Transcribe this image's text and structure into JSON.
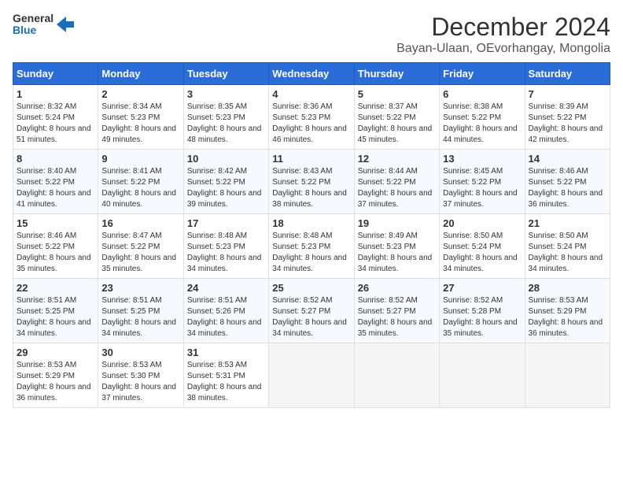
{
  "logo": {
    "text_general": "General",
    "text_blue": "Blue"
  },
  "title": "December 2024",
  "subtitle": "Bayan-Ulaan, OEvorhangay, Mongolia",
  "days_of_week": [
    "Sunday",
    "Monday",
    "Tuesday",
    "Wednesday",
    "Thursday",
    "Friday",
    "Saturday"
  ],
  "weeks": [
    [
      {
        "day": "1",
        "sunrise": "8:32 AM",
        "sunset": "5:24 PM",
        "daylight": "8 hours and 51 minutes."
      },
      {
        "day": "2",
        "sunrise": "8:34 AM",
        "sunset": "5:23 PM",
        "daylight": "8 hours and 49 minutes."
      },
      {
        "day": "3",
        "sunrise": "8:35 AM",
        "sunset": "5:23 PM",
        "daylight": "8 hours and 48 minutes."
      },
      {
        "day": "4",
        "sunrise": "8:36 AM",
        "sunset": "5:23 PM",
        "daylight": "8 hours and 46 minutes."
      },
      {
        "day": "5",
        "sunrise": "8:37 AM",
        "sunset": "5:22 PM",
        "daylight": "8 hours and 45 minutes."
      },
      {
        "day": "6",
        "sunrise": "8:38 AM",
        "sunset": "5:22 PM",
        "daylight": "8 hours and 44 minutes."
      },
      {
        "day": "7",
        "sunrise": "8:39 AM",
        "sunset": "5:22 PM",
        "daylight": "8 hours and 42 minutes."
      }
    ],
    [
      {
        "day": "8",
        "sunrise": "8:40 AM",
        "sunset": "5:22 PM",
        "daylight": "8 hours and 41 minutes."
      },
      {
        "day": "9",
        "sunrise": "8:41 AM",
        "sunset": "5:22 PM",
        "daylight": "8 hours and 40 minutes."
      },
      {
        "day": "10",
        "sunrise": "8:42 AM",
        "sunset": "5:22 PM",
        "daylight": "8 hours and 39 minutes."
      },
      {
        "day": "11",
        "sunrise": "8:43 AM",
        "sunset": "5:22 PM",
        "daylight": "8 hours and 38 minutes."
      },
      {
        "day": "12",
        "sunrise": "8:44 AM",
        "sunset": "5:22 PM",
        "daylight": "8 hours and 37 minutes."
      },
      {
        "day": "13",
        "sunrise": "8:45 AM",
        "sunset": "5:22 PM",
        "daylight": "8 hours and 37 minutes."
      },
      {
        "day": "14",
        "sunrise": "8:46 AM",
        "sunset": "5:22 PM",
        "daylight": "8 hours and 36 minutes."
      }
    ],
    [
      {
        "day": "15",
        "sunrise": "8:46 AM",
        "sunset": "5:22 PM",
        "daylight": "8 hours and 35 minutes."
      },
      {
        "day": "16",
        "sunrise": "8:47 AM",
        "sunset": "5:22 PM",
        "daylight": "8 hours and 35 minutes."
      },
      {
        "day": "17",
        "sunrise": "8:48 AM",
        "sunset": "5:23 PM",
        "daylight": "8 hours and 34 minutes."
      },
      {
        "day": "18",
        "sunrise": "8:48 AM",
        "sunset": "5:23 PM",
        "daylight": "8 hours and 34 minutes."
      },
      {
        "day": "19",
        "sunrise": "8:49 AM",
        "sunset": "5:23 PM",
        "daylight": "8 hours and 34 minutes."
      },
      {
        "day": "20",
        "sunrise": "8:50 AM",
        "sunset": "5:24 PM",
        "daylight": "8 hours and 34 minutes."
      },
      {
        "day": "21",
        "sunrise": "8:50 AM",
        "sunset": "5:24 PM",
        "daylight": "8 hours and 34 minutes."
      }
    ],
    [
      {
        "day": "22",
        "sunrise": "8:51 AM",
        "sunset": "5:25 PM",
        "daylight": "8 hours and 34 minutes."
      },
      {
        "day": "23",
        "sunrise": "8:51 AM",
        "sunset": "5:25 PM",
        "daylight": "8 hours and 34 minutes."
      },
      {
        "day": "24",
        "sunrise": "8:51 AM",
        "sunset": "5:26 PM",
        "daylight": "8 hours and 34 minutes."
      },
      {
        "day": "25",
        "sunrise": "8:52 AM",
        "sunset": "5:27 PM",
        "daylight": "8 hours and 34 minutes."
      },
      {
        "day": "26",
        "sunrise": "8:52 AM",
        "sunset": "5:27 PM",
        "daylight": "8 hours and 35 minutes."
      },
      {
        "day": "27",
        "sunrise": "8:52 AM",
        "sunset": "5:28 PM",
        "daylight": "8 hours and 35 minutes."
      },
      {
        "day": "28",
        "sunrise": "8:53 AM",
        "sunset": "5:29 PM",
        "daylight": "8 hours and 36 minutes."
      }
    ],
    [
      {
        "day": "29",
        "sunrise": "8:53 AM",
        "sunset": "5:29 PM",
        "daylight": "8 hours and 36 minutes."
      },
      {
        "day": "30",
        "sunrise": "8:53 AM",
        "sunset": "5:30 PM",
        "daylight": "8 hours and 37 minutes."
      },
      {
        "day": "31",
        "sunrise": "8:53 AM",
        "sunset": "5:31 PM",
        "daylight": "8 hours and 38 minutes."
      },
      null,
      null,
      null,
      null
    ]
  ]
}
